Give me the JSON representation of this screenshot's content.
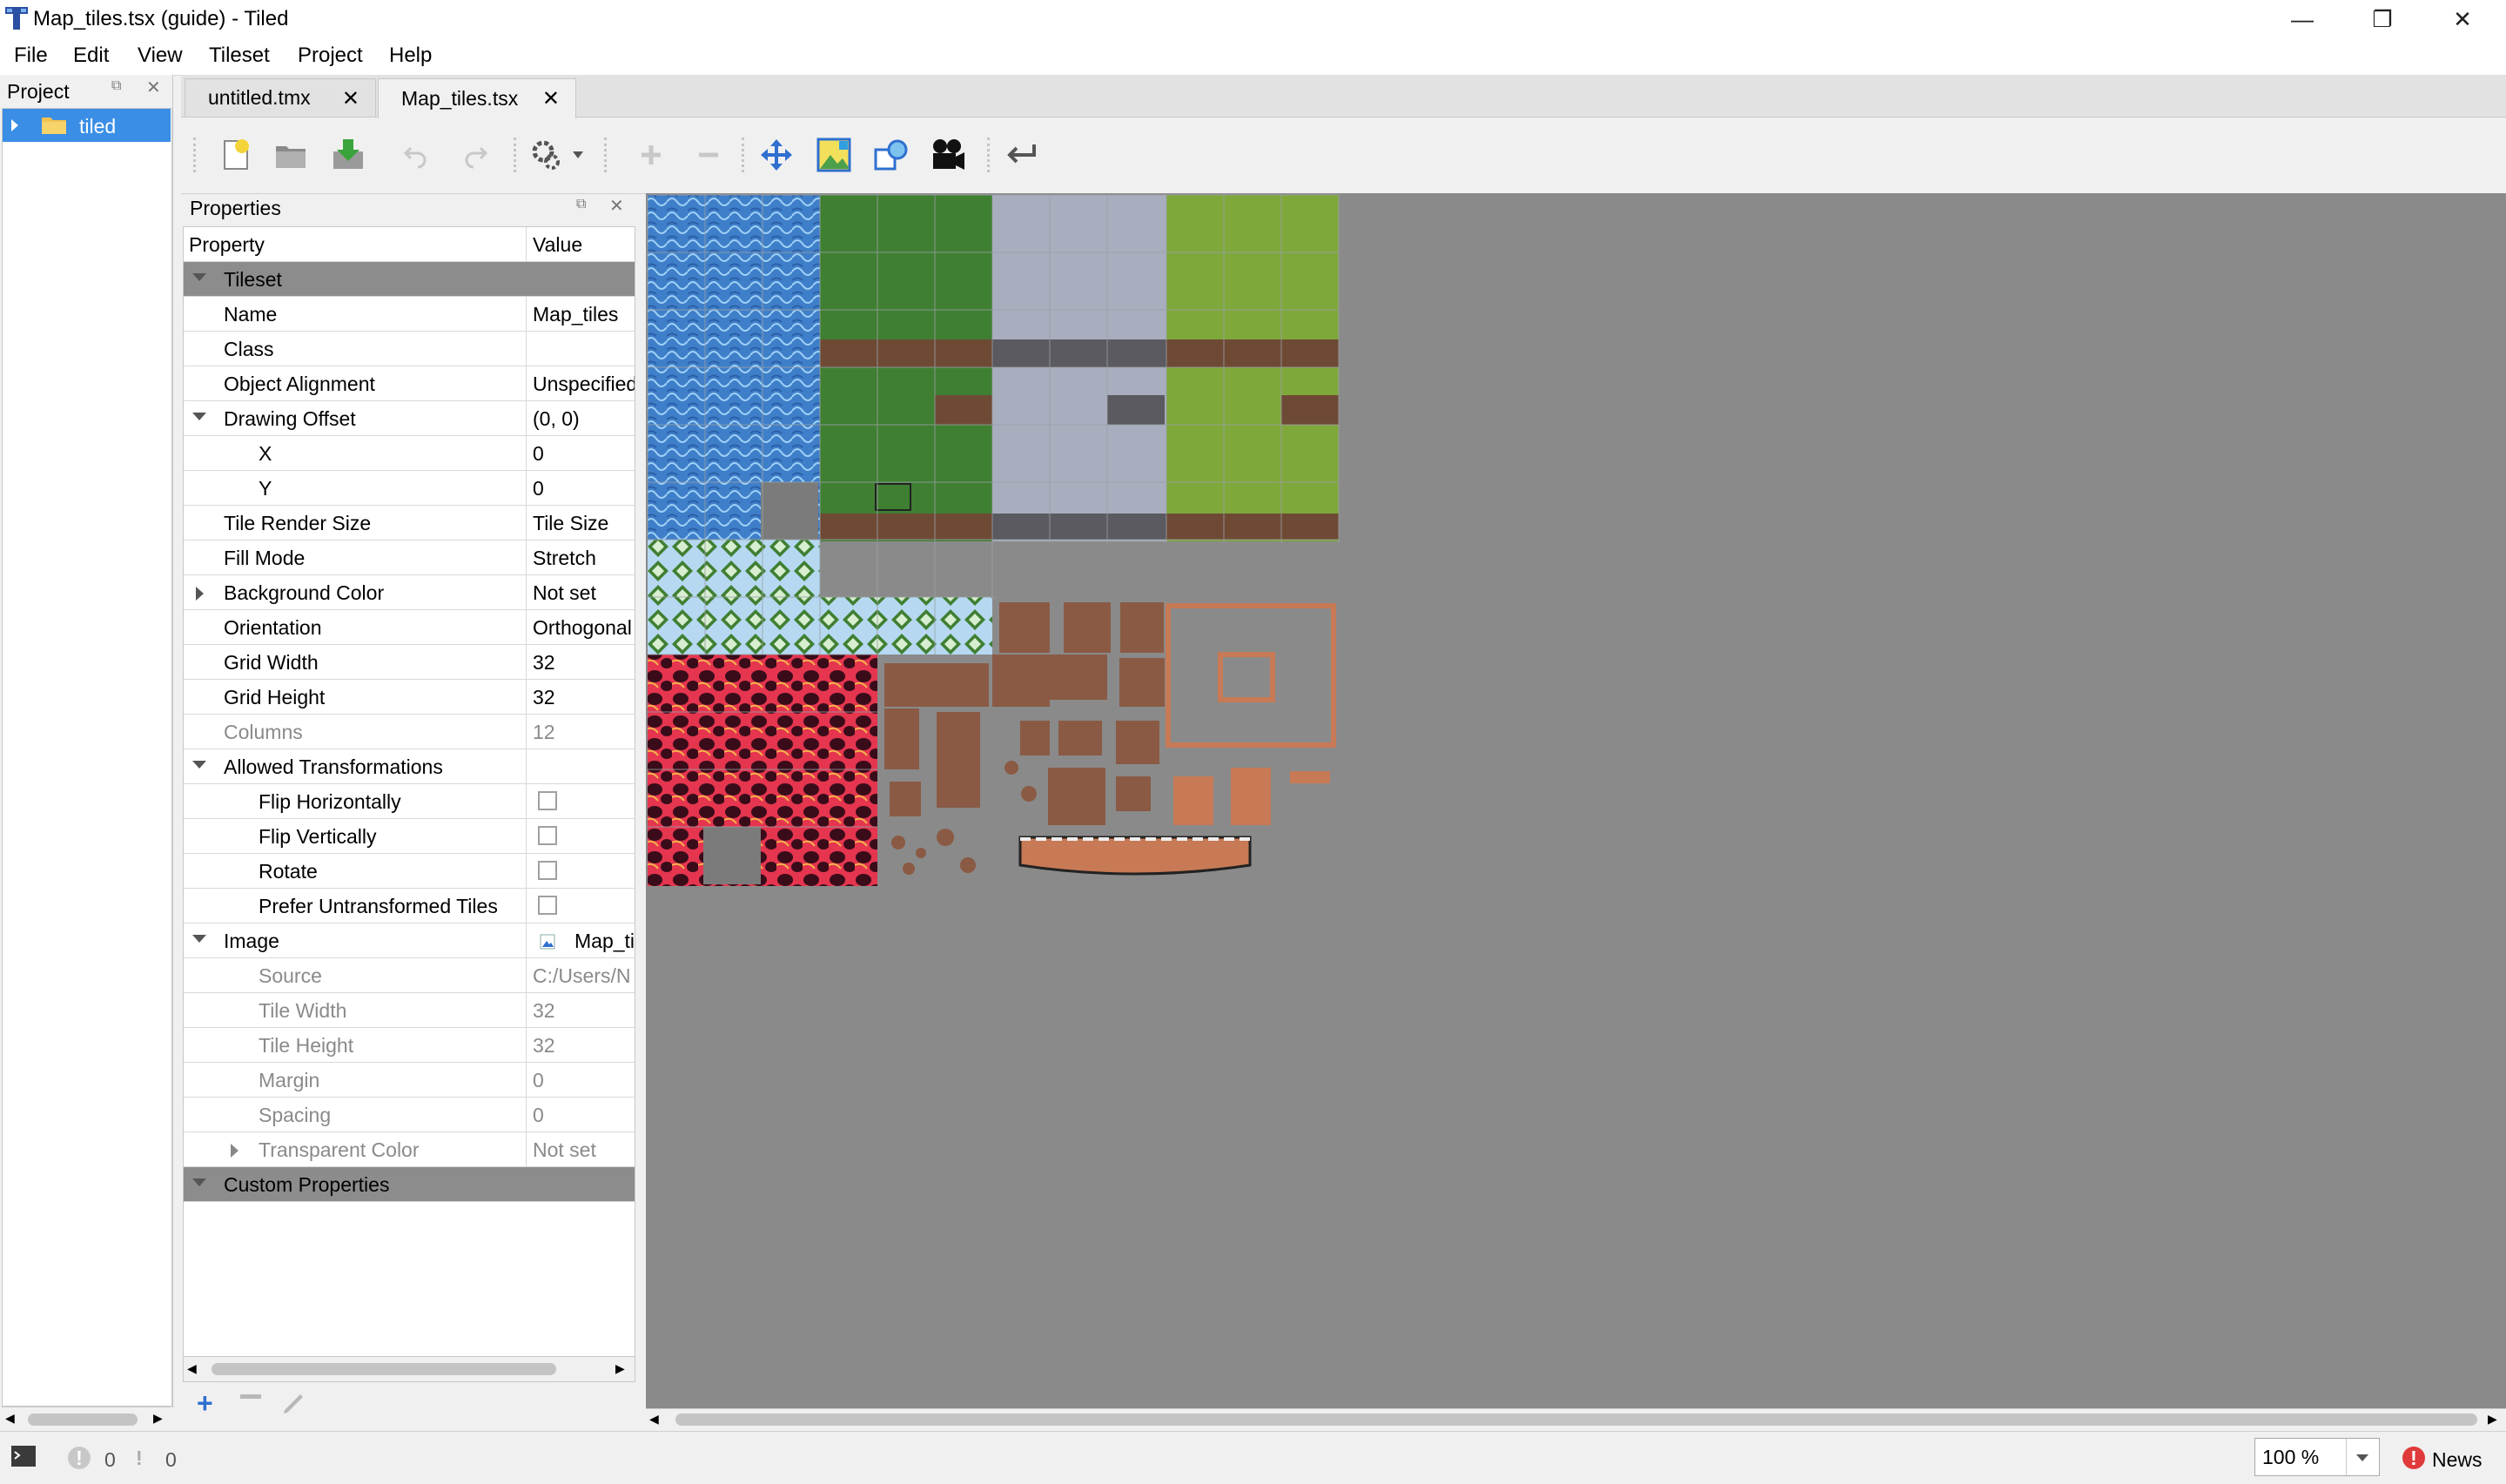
{
  "window": {
    "title": "Map_tiles.tsx (guide) - Tiled",
    "minimize_icon": "minimize-icon",
    "restore_icon": "restore-icon",
    "close_icon": "close-icon"
  },
  "menu": [
    "File",
    "Edit",
    "View",
    "Tileset",
    "Project",
    "Help"
  ],
  "project": {
    "title": "Project",
    "root_item": "tiled"
  },
  "tabs": [
    {
      "label": "untitled.tmx",
      "active": false
    },
    {
      "label": "Map_tiles.tsx",
      "active": true
    }
  ],
  "toolbar": {
    "buttons": [
      "new-tileset-icon",
      "open-icon",
      "save-icon",
      "undo-icon",
      "redo-icon",
      "tileset-properties-icon",
      "add-tiles-icon",
      "remove-tiles-icon",
      "dynamic-wrapping-icon",
      "edit-terrain-icon",
      "edit-collision-icon",
      "tile-animation-icon",
      "swap-icon"
    ]
  },
  "properties": {
    "title": "Properties",
    "col_property": "Property",
    "col_value": "Value",
    "groups": {
      "tileset": "Tileset",
      "custom": "Custom Properties"
    },
    "rows": {
      "name": {
        "label": "Name",
        "value": "Map_tiles"
      },
      "class": {
        "label": "Class",
        "value": ""
      },
      "object_alignment": {
        "label": "Object Alignment",
        "value": "Unspecified"
      },
      "drawing_offset": {
        "label": "Drawing Offset",
        "value": "(0, 0)"
      },
      "x": {
        "label": "X",
        "value": "0"
      },
      "y": {
        "label": "Y",
        "value": "0"
      },
      "tile_render_size": {
        "label": "Tile Render Size",
        "value": "Tile Size"
      },
      "fill_mode": {
        "label": "Fill Mode",
        "value": "Stretch"
      },
      "background_color": {
        "label": "Background Color",
        "value": "Not set"
      },
      "orientation": {
        "label": "Orientation",
        "value": "Orthogonal"
      },
      "grid_width": {
        "label": "Grid Width",
        "value": "32"
      },
      "grid_height": {
        "label": "Grid Height",
        "value": "32"
      },
      "columns": {
        "label": "Columns",
        "value": "12"
      },
      "allowed_transformations": {
        "label": "Allowed Transformations",
        "value": ""
      },
      "flip_h": {
        "label": "Flip Horizontally",
        "checked": false
      },
      "flip_v": {
        "label": "Flip Vertically",
        "checked": false
      },
      "rotate": {
        "label": "Rotate",
        "checked": false
      },
      "prefer_untransformed": {
        "label": "Prefer Untransformed Tiles",
        "checked": false
      },
      "image": {
        "label": "Image",
        "value": "Map_tiles.png"
      },
      "source": {
        "label": "Source",
        "value": "C:/Users/N"
      },
      "tile_width": {
        "label": "Tile Width",
        "value": "32"
      },
      "tile_height": {
        "label": "Tile Height",
        "value": "32"
      },
      "margin": {
        "label": "Margin",
        "value": "0"
      },
      "spacing": {
        "label": "Spacing",
        "value": "0"
      },
      "transparent_color": {
        "label": "Transparent Color",
        "value": "Not set"
      }
    }
  },
  "tileset_colors": {
    "canvas_bg": "#8a8a8a",
    "water": "#3f7fc9",
    "grass_dark": "#3f7f32",
    "stone": "#a9aebf",
    "grass_light": "#7fa83b",
    "dirt": "#6e4a35",
    "lava": "#b7243f",
    "brown": "#8a5a44",
    "wood": "#c77a55"
  },
  "status": {
    "errors": "0",
    "warnings": "0",
    "zoom": "100 %",
    "news": "News"
  }
}
